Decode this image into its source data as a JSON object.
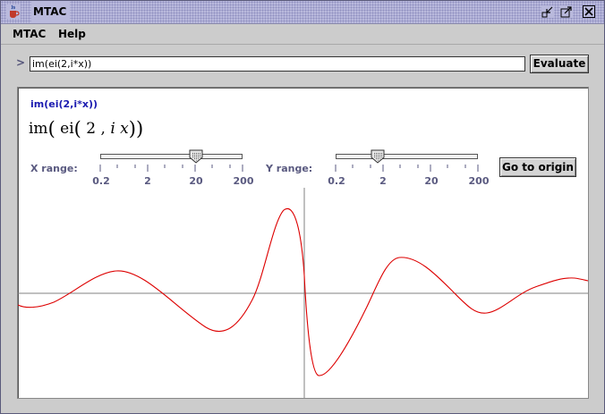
{
  "window": {
    "title": "MTAC",
    "icon": "java-cup-icon",
    "controls": [
      "minimize-icon",
      "maximize-icon",
      "close-icon"
    ]
  },
  "menu": {
    "items": [
      "MTAC",
      "Help"
    ]
  },
  "input": {
    "prompt": ">",
    "value": "im(ei(2,i*x))"
  },
  "buttons": {
    "evaluate": "Evaluate",
    "go_to_origin": "Go to origin"
  },
  "panel": {
    "expression_text": "im(ei(2,i*x))",
    "math": {
      "outer": "im",
      "inner": "ei",
      "arg1": "2",
      "sep": ",",
      "arg2_i": "i",
      "arg2_x": "x"
    },
    "x_range": {
      "label": "X range:",
      "ticks": [
        "0.2",
        "2",
        "20",
        "200"
      ],
      "value": 20
    },
    "y_range": {
      "label": "Y range:",
      "ticks": [
        "0.2",
        "2",
        "20",
        "200"
      ],
      "value": 2
    }
  },
  "chart_data": {
    "type": "line",
    "title": "",
    "xlabel": "",
    "ylabel": "",
    "curve_color": "#dd0000",
    "axis_color": "#808080",
    "grid": false
  }
}
